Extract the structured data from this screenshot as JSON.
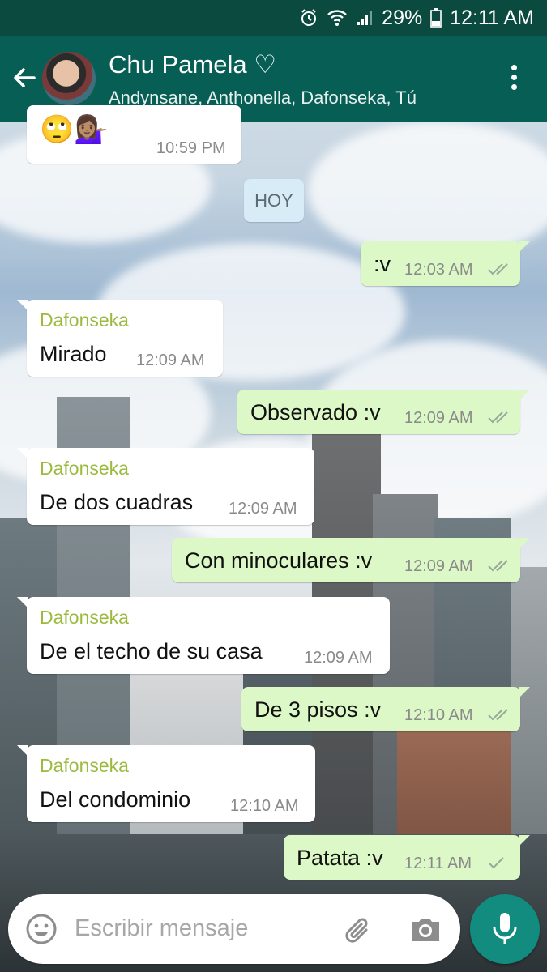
{
  "status_bar": {
    "icons": [
      "alarm-icon",
      "wifi-icon",
      "signal-icon",
      "battery-icon"
    ],
    "battery_percent": "29%",
    "time": "12:11 AM"
  },
  "header": {
    "title": "Chu Pamela ♡",
    "subtitle": "Andynsane, Anthonella, Dafonseka, Tú",
    "colors": {
      "bar": "#075e54",
      "status_bar": "#0a4a3f"
    }
  },
  "day_separator": "HOY",
  "messages": [
    {
      "direction": "in",
      "sender": "",
      "text": "🙄💁🏽‍♀️",
      "time": "10:59 PM",
      "ticks": ""
    },
    {
      "direction": "out",
      "sender": "",
      "text": ":v",
      "time": "12:03 AM",
      "ticks": "double-check-icon"
    },
    {
      "direction": "in",
      "sender": "Dafonseka",
      "text": "Mirado",
      "time": "12:09 AM",
      "ticks": ""
    },
    {
      "direction": "out",
      "sender": "",
      "text": "Observado :v",
      "time": "12:09 AM",
      "ticks": "double-check-icon"
    },
    {
      "direction": "in",
      "sender": "Dafonseka",
      "text": "De dos cuadras",
      "time": "12:09 AM",
      "ticks": ""
    },
    {
      "direction": "out",
      "sender": "",
      "text": "Con minoculares :v",
      "time": "12:09 AM",
      "ticks": "double-check-icon"
    },
    {
      "direction": "in",
      "sender": "Dafonseka",
      "text": "De el techo de su casa",
      "time": "12:09 AM",
      "ticks": ""
    },
    {
      "direction": "out",
      "sender": "",
      "text": "De 3 pisos :v",
      "time": "12:10 AM",
      "ticks": "double-check-icon"
    },
    {
      "direction": "in",
      "sender": "Dafonseka",
      "text": "Del condominio",
      "time": "12:10 AM",
      "ticks": ""
    },
    {
      "direction": "out",
      "sender": "",
      "text": "Patata :v",
      "time": "12:11 AM",
      "ticks": "single-check-icon"
    }
  ],
  "composer": {
    "placeholder": "Escribir mensaje",
    "icons": [
      "emoji-icon",
      "paperclip-icon",
      "camera-icon",
      "microphone-icon"
    ]
  },
  "colors": {
    "incoming_bubble": "#ffffff",
    "outgoing_bubble": "#dcf8c6",
    "sender_name": "#9cba3f",
    "fab": "#128c7e"
  }
}
